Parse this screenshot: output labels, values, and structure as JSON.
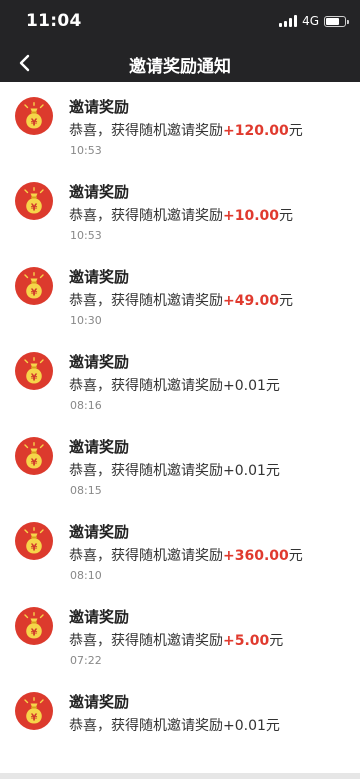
{
  "status_bar": {
    "time": "11:04",
    "network": "4G",
    "battery_level": 0.7
  },
  "nav": {
    "back_icon": "chevron-left-icon",
    "title": "邀请奖励通知"
  },
  "colors": {
    "header_bg": "#242426",
    "avatar_bg": "#dc3a2d",
    "amount_highlight": "#e03a2e"
  },
  "notifications": [
    {
      "title": "邀请奖励",
      "message": "恭喜，获得随机邀请奖励",
      "amount": "+120.00",
      "unit": "元",
      "highlight": true,
      "time": "10:53"
    },
    {
      "title": "邀请奖励",
      "message": "恭喜，获得随机邀请奖励",
      "amount": "+10.00",
      "unit": "元",
      "highlight": true,
      "time": "10:53"
    },
    {
      "title": "邀请奖励",
      "message": "恭喜，获得随机邀请奖励",
      "amount": "+49.00",
      "unit": "元",
      "highlight": true,
      "time": "10:30"
    },
    {
      "title": "邀请奖励",
      "message": "恭喜，获得随机邀请奖励",
      "amount": "+0.01",
      "unit": "元",
      "highlight": false,
      "time": "08:16"
    },
    {
      "title": "邀请奖励",
      "message": "恭喜，获得随机邀请奖励",
      "amount": "+0.01",
      "unit": "元",
      "highlight": false,
      "time": "08:15"
    },
    {
      "title": "邀请奖励",
      "message": "恭喜，获得随机邀请奖励",
      "amount": "+360.00",
      "unit": "元",
      "highlight": true,
      "time": "08:10"
    },
    {
      "title": "邀请奖励",
      "message": "恭喜，获得随机邀请奖励",
      "amount": "+5.00",
      "unit": "元",
      "highlight": true,
      "time": "07:22"
    },
    {
      "title": "邀请奖励",
      "message": "恭喜，获得随机邀请奖励",
      "amount": "+0.01",
      "unit": "元",
      "highlight": false,
      "time": ""
    }
  ],
  "notification_icon": "money-bag-icon"
}
